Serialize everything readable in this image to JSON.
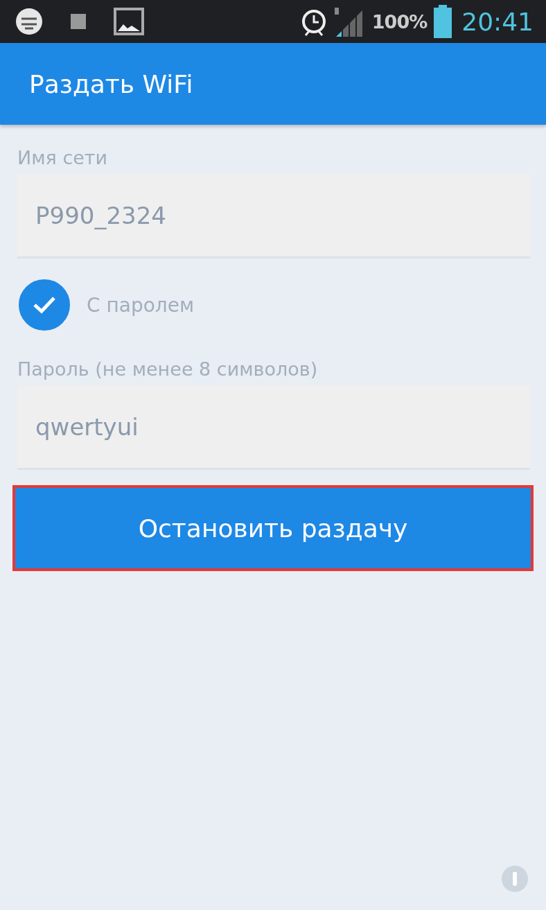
{
  "status_bar": {
    "battery": "100%",
    "time": "20:41"
  },
  "app_bar": {
    "title": "Раздать WiFi"
  },
  "form": {
    "network_name": {
      "label": "Имя сети",
      "value": "P990_2324"
    },
    "password_toggle": {
      "label": "С паролем",
      "checked": true
    },
    "password": {
      "label": "Пароль (не менее 8 символов)",
      "value": "qwertyui"
    },
    "button": {
      "label": "Остановить раздачу",
      "highlighted": true
    }
  }
}
